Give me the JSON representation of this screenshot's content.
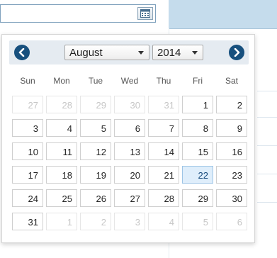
{
  "input": {
    "value": "",
    "placeholder": ""
  },
  "calendar": {
    "month": "August",
    "year": "2014",
    "prev_icon": "chevron-left-circle-icon",
    "next_icon": "chevron-right-circle-icon",
    "weekdays": [
      "Sun",
      "Mon",
      "Tue",
      "Wed",
      "Thu",
      "Fri",
      "Sat"
    ],
    "weeks": [
      [
        "27",
        "28",
        "29",
        "30",
        "31",
        "1",
        "2"
      ],
      [
        "3",
        "4",
        "5",
        "6",
        "7",
        "8",
        "9"
      ],
      [
        "10",
        "11",
        "12",
        "13",
        "14",
        "15",
        "16"
      ],
      [
        "17",
        "18",
        "19",
        "20",
        "21",
        "22",
        "23"
      ],
      [
        "24",
        "25",
        "26",
        "27",
        "28",
        "29",
        "30"
      ],
      [
        "31",
        "1",
        "2",
        "3",
        "4",
        "5",
        "6"
      ]
    ],
    "selected_day": "22"
  },
  "colors": {
    "nav": "#17507e",
    "header_bg": "#e5ebf1",
    "selected_bg": "#dfeefb",
    "table_header": "#c5dcec"
  }
}
